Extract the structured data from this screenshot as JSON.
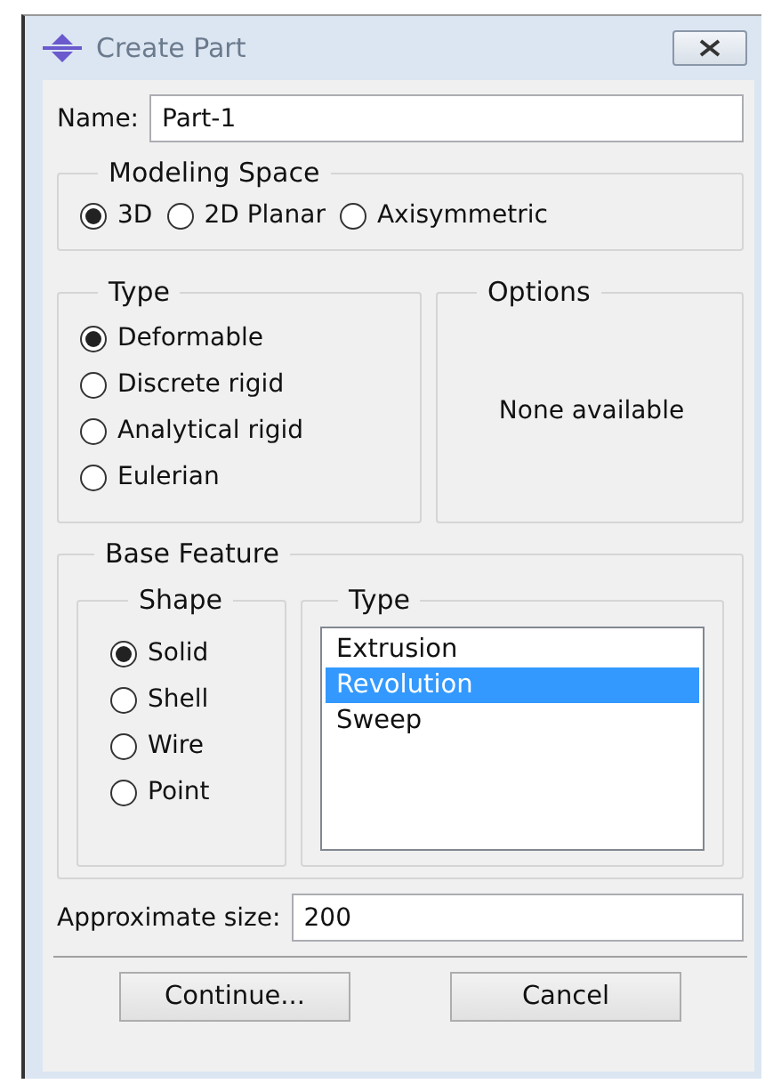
{
  "window": {
    "title": "Create Part"
  },
  "name": {
    "label": "Name:",
    "value": "Part-1"
  },
  "modeling_space": {
    "title": "Modeling Space",
    "options": [
      {
        "label": "3D",
        "selected": true
      },
      {
        "label": "2D Planar",
        "selected": false
      },
      {
        "label": "Axisymmetric",
        "selected": false
      }
    ]
  },
  "type": {
    "title": "Type",
    "options": [
      {
        "label": "Deformable",
        "selected": true
      },
      {
        "label": "Discrete rigid",
        "selected": false
      },
      {
        "label": "Analytical rigid",
        "selected": false
      },
      {
        "label": "Eulerian",
        "selected": false
      }
    ]
  },
  "options": {
    "title": "Options",
    "text": "None available"
  },
  "base_feature": {
    "title": "Base Feature",
    "shape": {
      "title": "Shape",
      "options": [
        {
          "label": "Solid",
          "selected": true
        },
        {
          "label": "Shell",
          "selected": false
        },
        {
          "label": "Wire",
          "selected": false
        },
        {
          "label": "Point",
          "selected": false
        }
      ]
    },
    "type": {
      "title": "Type",
      "items": [
        {
          "label": "Extrusion",
          "selected": false
        },
        {
          "label": "Revolution",
          "selected": true
        },
        {
          "label": "Sweep",
          "selected": false
        }
      ]
    }
  },
  "approximate_size": {
    "label": "Approximate size:",
    "value": "200"
  },
  "buttons": [
    "Continue...",
    "Cancel"
  ]
}
